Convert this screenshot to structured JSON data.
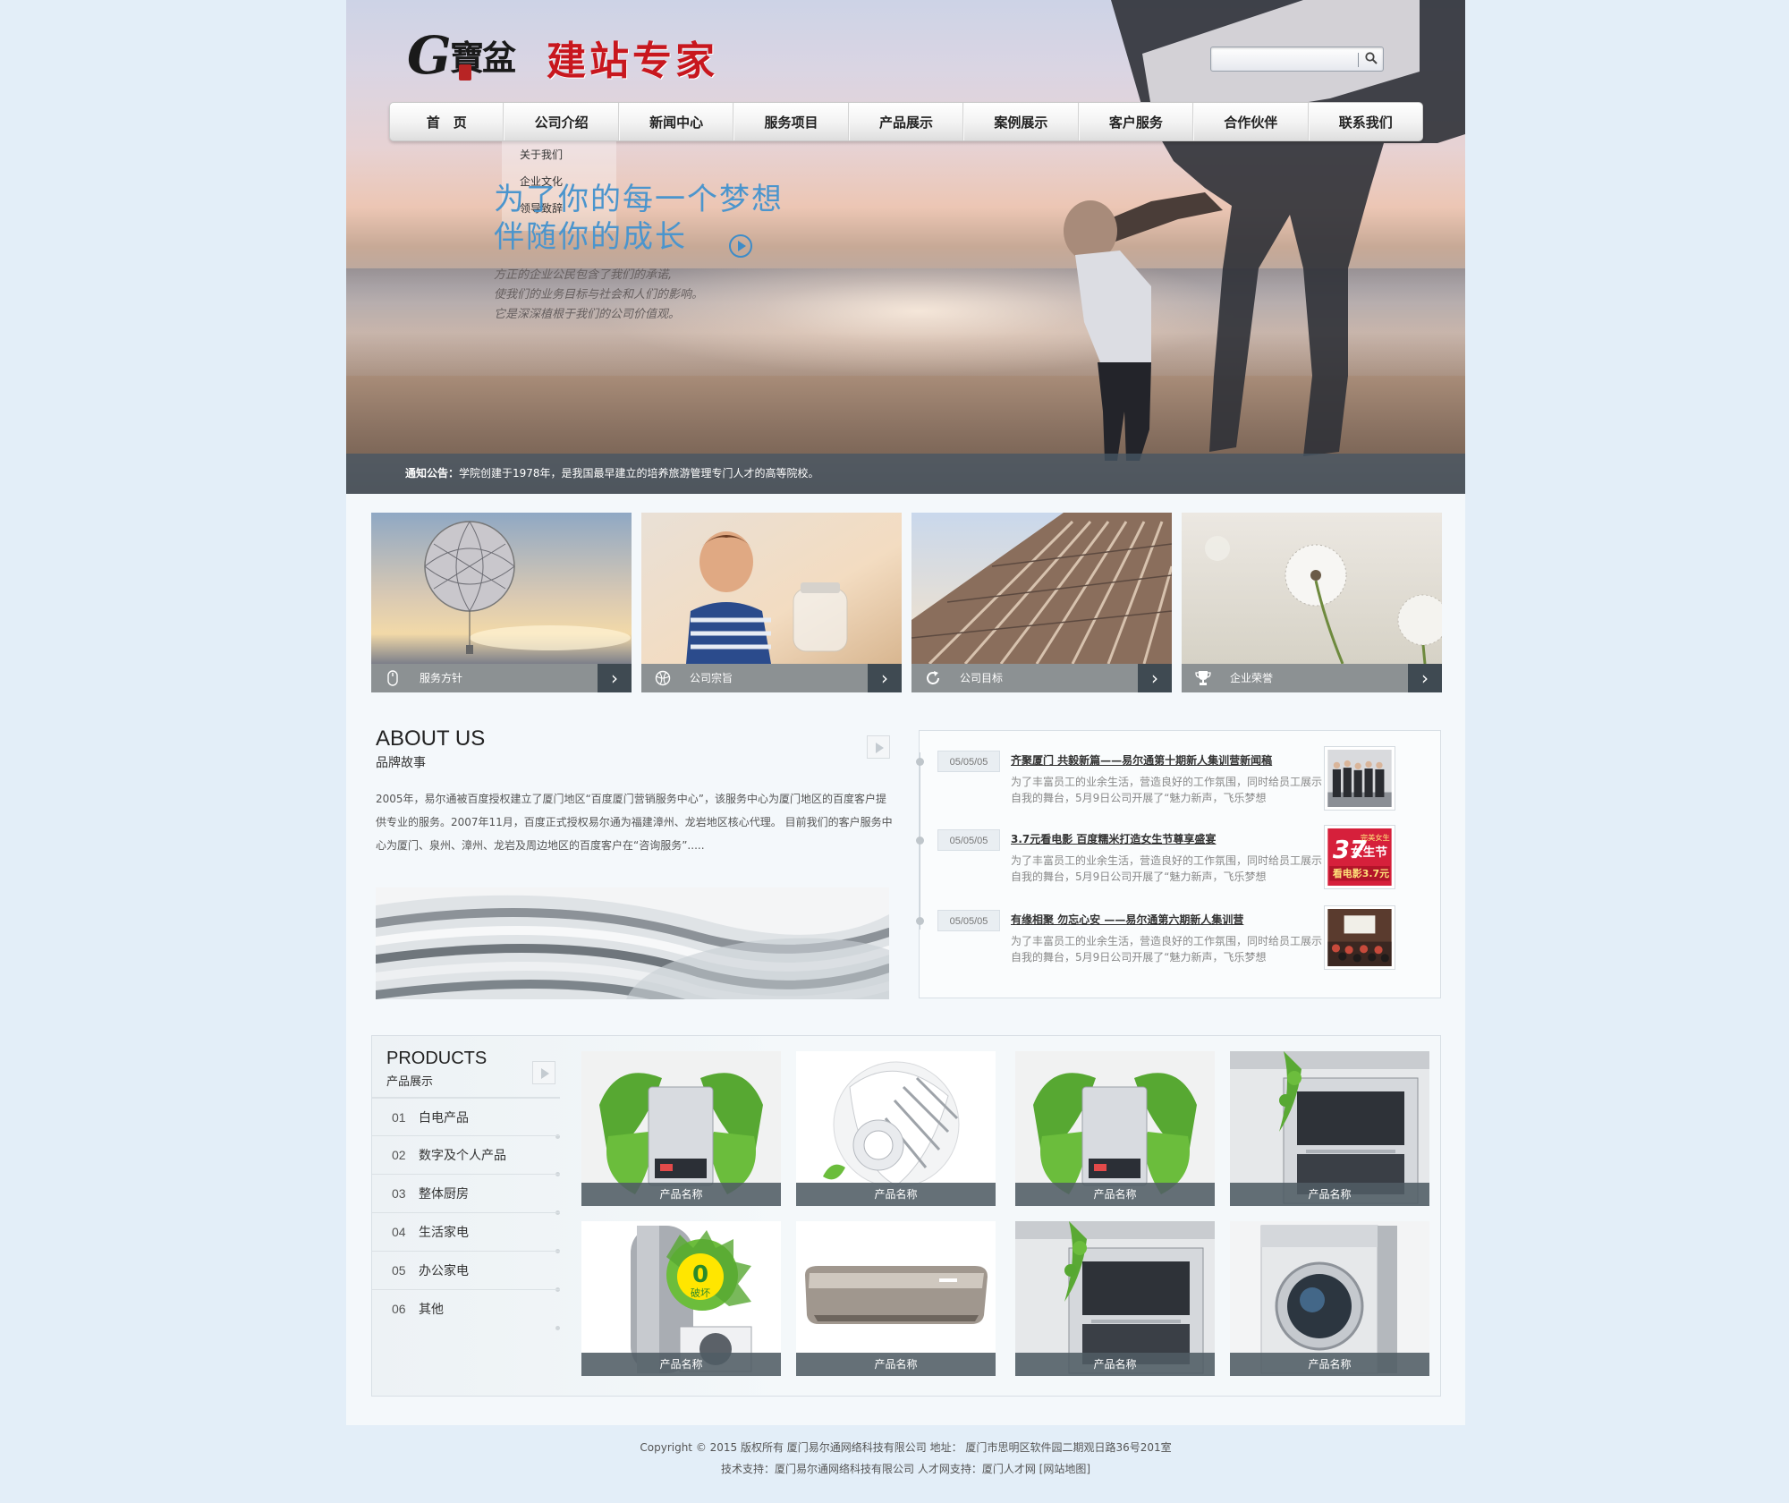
{
  "logo": {
    "mark": "G",
    "script": "寶盆",
    "title": "建站专家"
  },
  "search": {
    "value": ""
  },
  "nav": [
    {
      "label": "首　页"
    },
    {
      "label": "公司介绍"
    },
    {
      "label": "新闻中心"
    },
    {
      "label": "服务项目"
    },
    {
      "label": "产品展示"
    },
    {
      "label": "案例展示"
    },
    {
      "label": "客户服务"
    },
    {
      "label": "合作伙伴"
    },
    {
      "label": "联系我们"
    }
  ],
  "subnav": [
    {
      "label": "关于我们"
    },
    {
      "label": "企业文化"
    },
    {
      "label": "领导致辞"
    }
  ],
  "hero": {
    "line1": "为了你的每一个梦想",
    "line2": "伴随你的成长",
    "tagline1": "方正的企业公民包含了我们的承诺,",
    "tagline2": "使我们的业务目标与社会和人们的影响。",
    "tagline3": "它是深深植根于我们的公司价值观。"
  },
  "notice": {
    "label": "通知公告：",
    "text": "学院创建于1978年，是我国最早建立的培养旅游管理专门人才的高等院校。"
  },
  "features": [
    {
      "label": "服务方针",
      "icon": "mouse-icon"
    },
    {
      "label": "公司宗旨",
      "icon": "globe-icon"
    },
    {
      "label": "公司目标",
      "icon": "refresh-icon"
    },
    {
      "label": "企业荣誉",
      "icon": "trophy-icon"
    }
  ],
  "about": {
    "title": "ABOUT US",
    "subtitle": "品牌故事",
    "text": "2005年，易尔通被百度授权建立了厦门地区“百度厦门营销服务中心”，该服务中心为厦门地区的百度客户提供专业的服务。2007年11月，百度正式授权易尔通为福建漳州、龙岩地区核心代理。 目前我们的客户服务中心为厦门、泉州、漳州、龙岩及周边地区的百度客户在“咨询服务”....."
  },
  "news": [
    {
      "date": "05/05/05",
      "title": "齐聚厦门 共毅新篇——易尔通第十期新人集训营新闻稿",
      "desc": "为了丰富员工的业余生活，营造良好的工作氛围，同时给员工展示自我的舞台，5月9日公司开展了“魅力新声，飞乐梦想"
    },
    {
      "date": "05/05/05",
      "title": "3.7元看电影 百度糯米打造女生节尊享盛宴",
      "desc": "为了丰富员工的业余生活，营造良好的工作氛围，同时给员工展示自我的舞台，5月9日公司开展了“魅力新声，飞乐梦想",
      "thumb_big": "37",
      "thumb_top": "完美女生",
      "thumb_mid": "女生节",
      "thumb_bottom": "看电影3.7元"
    },
    {
      "date": "05/05/05",
      "title": "有缘相聚 勿忘心安 ——易尔通第六期新人集训营",
      "desc": "为了丰富员工的业余生活，营造良好的工作氛围，同时给员工展示自我的舞台，5月9日公司开展了“魅力新声，飞乐梦想"
    }
  ],
  "products": {
    "title": "PRODUCTS",
    "subtitle": "产品展示",
    "categories": [
      {
        "num": "01",
        "label": "白电产品"
      },
      {
        "num": "02",
        "label": "数字及个人产品"
      },
      {
        "num": "03",
        "label": "整体厨房"
      },
      {
        "num": "04",
        "label": "生活家电"
      },
      {
        "num": "05",
        "label": "办公家电"
      },
      {
        "num": "06",
        "label": "其他"
      }
    ],
    "items": [
      {
        "label": "产品名称",
        "kind": "water-heater"
      },
      {
        "label": "产品名称",
        "kind": "fan"
      },
      {
        "label": "产品名称",
        "kind": "water-heater"
      },
      {
        "label": "产品名称",
        "kind": "oven"
      },
      {
        "label": "产品名称",
        "kind": "heat-pump",
        "badge_num": "0",
        "badge_text": "破坏"
      },
      {
        "label": "产品名称",
        "kind": "air-conditioner"
      },
      {
        "label": "产品名称",
        "kind": "oven"
      },
      {
        "label": "产品名称",
        "kind": "washing-machine"
      }
    ]
  },
  "footer": {
    "line1": "Copyright © 2015 版权所有 厦门易尔通网络科技有限公司  地址： 厦门市思明区软件园二期观日路36号201室",
    "line2": "技术支持：厦门易尔通网络科技有限公司 人才网支持：厦门人才网  [网站地图]"
  }
}
